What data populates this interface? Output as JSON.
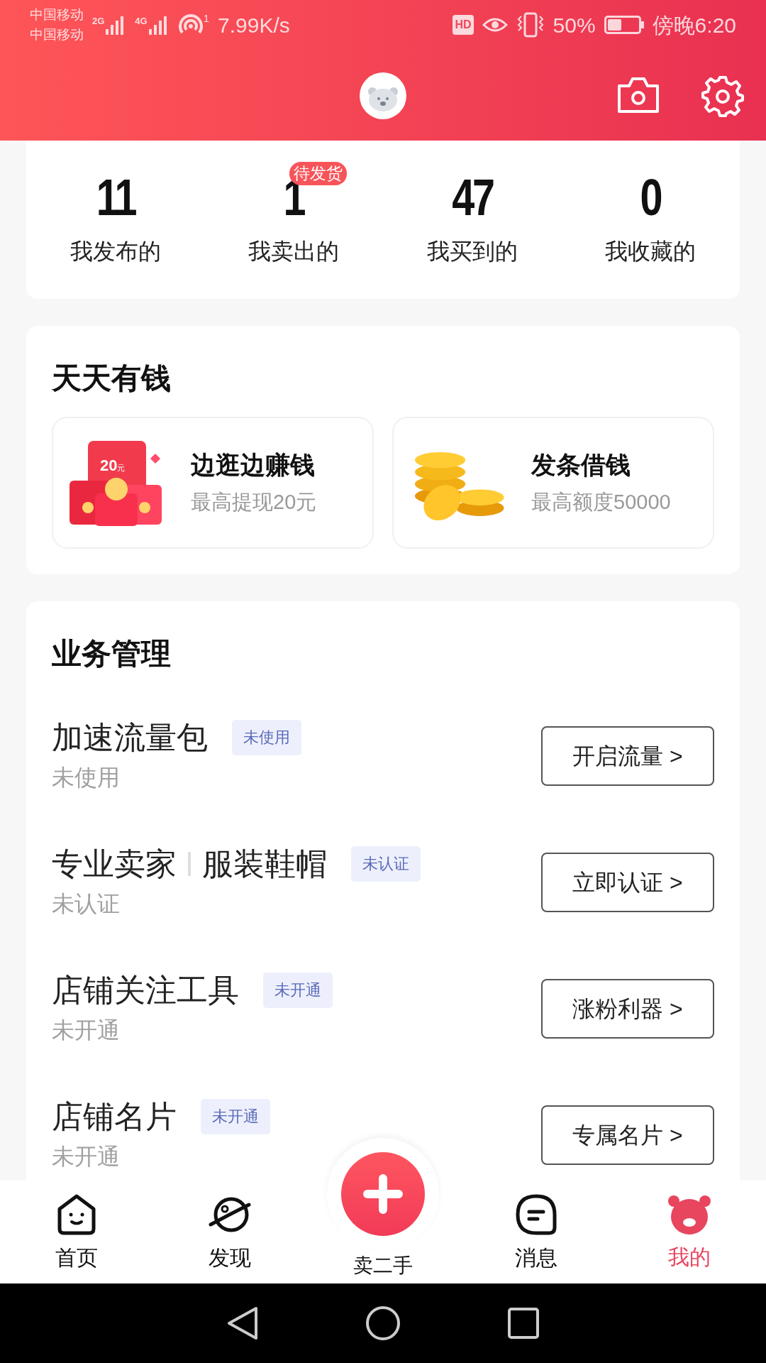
{
  "status_bar": {
    "carriers": [
      "中国移动",
      "中国移动"
    ],
    "signal_labels": [
      "2G",
      "4G"
    ],
    "hotspot_count": "1",
    "network_speed": "7.99K/s",
    "hd": "HD",
    "battery_percent": "50%",
    "time": "傍晚6:20"
  },
  "stats": [
    {
      "value": "11",
      "label": "我发布的"
    },
    {
      "value": "1",
      "label": "我卖出的",
      "badge": "待发货"
    },
    {
      "value": "47",
      "label": "我买到的"
    },
    {
      "value": "0",
      "label": "我收藏的"
    }
  ],
  "money": {
    "title": "天天有钱",
    "cards": [
      {
        "title": "边逛边赚钱",
        "subtitle": "最高提现20元",
        "amount": "20",
        "unit": "元"
      },
      {
        "title": "发条借钱",
        "subtitle": "最高额度50000"
      }
    ]
  },
  "business": {
    "title": "业务管理",
    "rows": [
      {
        "title_parts": [
          "加速流量包"
        ],
        "badge": "未使用",
        "status": "未使用",
        "button": "开启流量 >"
      },
      {
        "title_parts": [
          "专业卖家",
          "服装鞋帽"
        ],
        "badge": "未认证",
        "status": "未认证",
        "button": "立即认证 >"
      },
      {
        "title_parts": [
          "店铺关注工具"
        ],
        "badge": "未开通",
        "status": "未开通",
        "button": "涨粉利器 >"
      },
      {
        "title_parts": [
          "店铺名片"
        ],
        "badge": "未开通",
        "status": "未开通",
        "button": "专属名片 >"
      }
    ]
  },
  "bottom_nav": [
    {
      "kind": "tab",
      "label": "首页",
      "selected": false
    },
    {
      "kind": "tab",
      "label": "发现",
      "selected": false
    },
    {
      "kind": "center",
      "label": "卖二手",
      "selected": false
    },
    {
      "kind": "tab",
      "label": "消息",
      "selected": false
    },
    {
      "kind": "tab",
      "label": "我的",
      "selected": true
    }
  ]
}
